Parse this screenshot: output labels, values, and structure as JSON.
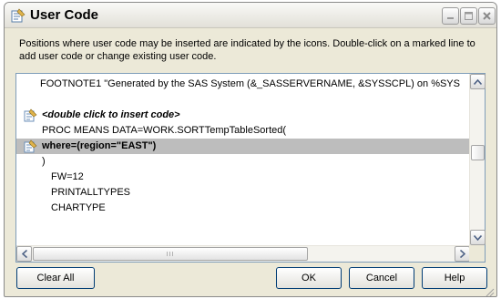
{
  "window": {
    "title": "User Code",
    "title_icon": "code-editor-icon",
    "controls": [
      "minimize-icon",
      "maximize-icon",
      "close-icon"
    ]
  },
  "instructions": "Positions where user code may be inserted are indicated by the icons. Double-click on a marked line to add user code or change existing user code.",
  "code_lines": [
    {
      "text": "FOOTNOTE1 \"Generated by the SAS System (&_SASSERVERNAME, &SYSSCPL) on %SYS",
      "icon": "",
      "style": "normal",
      "highlighted": false
    },
    {
      "text": "",
      "icon": "",
      "style": "normal",
      "highlighted": false
    },
    {
      "text": "<double click to insert code>",
      "icon": "insert-code-marker-icon",
      "style": "italic",
      "highlighted": false
    },
    {
      "text": "PROC MEANS DATA=WORK.SORTTempTableSorted(",
      "icon": "",
      "style": "normal",
      "highlighted": false
    },
    {
      "text": "where=(region=\"EAST\")",
      "icon": "user-code-marker-icon",
      "style": "bold",
      "highlighted": true
    },
    {
      "text": ")",
      "icon": "",
      "style": "normal",
      "highlighted": false
    },
    {
      "text": "FW=12",
      "icon": "",
      "style": "normal",
      "highlighted": false
    },
    {
      "text": "PRINTALLTYPES",
      "icon": "",
      "style": "normal",
      "highlighted": false
    },
    {
      "text": "CHARTYPE",
      "icon": "",
      "style": "normal",
      "highlighted": false
    }
  ],
  "buttons": {
    "clear_all": "Clear All",
    "ok": "OK",
    "cancel": "Cancel",
    "help": "Help"
  },
  "scroll": {
    "grip": "III"
  },
  "colors": {
    "dialog_bg": "#ece9d8",
    "highlight_row": "#bdbdbd",
    "pane_border": "#7f9db9"
  }
}
